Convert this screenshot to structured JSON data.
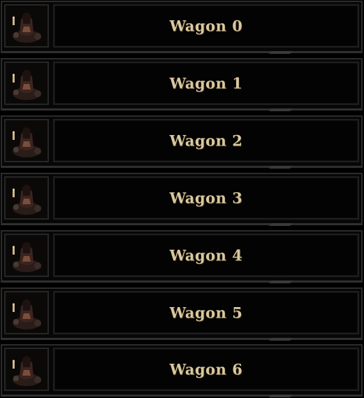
{
  "wagons": [
    {
      "label": "Wagon 0"
    },
    {
      "label": "Wagon 1"
    },
    {
      "label": "Wagon 2"
    },
    {
      "label": "Wagon 3"
    },
    {
      "label": "Wagon 4"
    },
    {
      "label": "Wagon 5"
    },
    {
      "label": "Wagon 6"
    }
  ],
  "portrait_icon": "hero-portrait-icon",
  "colors": {
    "label_text": "#d9c79e",
    "background": "#000000",
    "frame": "#2b2b2b"
  }
}
